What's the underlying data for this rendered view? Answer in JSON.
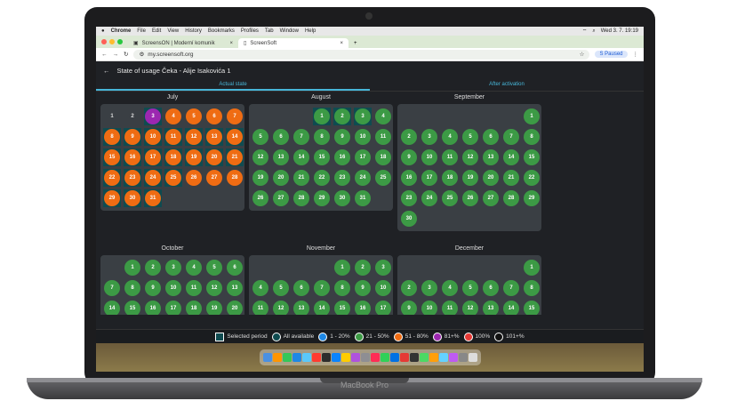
{
  "menubar": {
    "app": "Chrome",
    "items": [
      "File",
      "Edit",
      "View",
      "History",
      "Bookmarks",
      "Profiles",
      "Tab",
      "Window",
      "Help"
    ],
    "clock": "Wed 3. 7.  19:19"
  },
  "tabs": [
    {
      "label": "ScreensON | Moderní komunik",
      "close": "×"
    },
    {
      "label": "ScreenSoft",
      "close": "×"
    }
  ],
  "new_tab": "+",
  "address": {
    "url": "my.screensoft.org",
    "paused": "Paused",
    "profile_initial": "S"
  },
  "app": {
    "back": "←",
    "title": "State of usage  Čeka - Alije Isakovića 1"
  },
  "view_tabs": [
    {
      "label": "Actual state"
    },
    {
      "label": "After activation"
    }
  ],
  "months": [
    {
      "name": "July",
      "offset": 0,
      "days": [
        {
          "d": "1",
          "s": "n",
          "sel": false
        },
        {
          "d": "2",
          "s": "n",
          "sel": false
        },
        {
          "d": "3",
          "s": "p",
          "sel": true
        },
        {
          "d": "4",
          "s": "o",
          "sel": false
        },
        {
          "d": "5",
          "s": "o",
          "sel": false
        },
        {
          "d": "6",
          "s": "o",
          "sel": false
        },
        {
          "d": "7",
          "s": "o",
          "sel": false
        },
        {
          "d": "8",
          "s": "o",
          "sel": true
        },
        {
          "d": "9",
          "s": "o",
          "sel": true
        },
        {
          "d": "10",
          "s": "o",
          "sel": true
        },
        {
          "d": "11",
          "s": "o",
          "sel": true
        },
        {
          "d": "12",
          "s": "o",
          "sel": true
        },
        {
          "d": "13",
          "s": "o",
          "sel": true
        },
        {
          "d": "14",
          "s": "o",
          "sel": true
        },
        {
          "d": "15",
          "s": "o",
          "sel": true
        },
        {
          "d": "16",
          "s": "o",
          "sel": true
        },
        {
          "d": "17",
          "s": "o",
          "sel": true
        },
        {
          "d": "18",
          "s": "o",
          "sel": true
        },
        {
          "d": "19",
          "s": "o",
          "sel": true
        },
        {
          "d": "20",
          "s": "o",
          "sel": true
        },
        {
          "d": "21",
          "s": "o",
          "sel": true
        },
        {
          "d": "22",
          "s": "o",
          "sel": true
        },
        {
          "d": "23",
          "s": "o",
          "sel": true
        },
        {
          "d": "24",
          "s": "o",
          "sel": true
        },
        {
          "d": "25",
          "s": "o",
          "sel": true
        },
        {
          "d": "26",
          "s": "o",
          "sel": false
        },
        {
          "d": "27",
          "s": "o",
          "sel": false
        },
        {
          "d": "28",
          "s": "o",
          "sel": false
        },
        {
          "d": "29",
          "s": "o",
          "sel": true
        },
        {
          "d": "30",
          "s": "o",
          "sel": true
        },
        {
          "d": "31",
          "s": "o",
          "sel": true
        }
      ]
    },
    {
      "name": "August",
      "offset": 3,
      "days": [
        {
          "d": "1",
          "s": "g",
          "sel": true
        },
        {
          "d": "2",
          "s": "g",
          "sel": true
        },
        {
          "d": "3",
          "s": "g",
          "sel": true
        },
        {
          "d": "4",
          "s": "g",
          "sel": false
        },
        {
          "d": "5",
          "s": "g"
        },
        {
          "d": "6",
          "s": "g"
        },
        {
          "d": "7",
          "s": "g"
        },
        {
          "d": "8",
          "s": "g"
        },
        {
          "d": "9",
          "s": "g"
        },
        {
          "d": "10",
          "s": "g"
        },
        {
          "d": "11",
          "s": "g"
        },
        {
          "d": "12",
          "s": "g"
        },
        {
          "d": "13",
          "s": "g"
        },
        {
          "d": "14",
          "s": "g"
        },
        {
          "d": "15",
          "s": "g"
        },
        {
          "d": "16",
          "s": "g"
        },
        {
          "d": "17",
          "s": "g"
        },
        {
          "d": "18",
          "s": "g"
        },
        {
          "d": "19",
          "s": "g"
        },
        {
          "d": "20",
          "s": "g"
        },
        {
          "d": "21",
          "s": "g"
        },
        {
          "d": "22",
          "s": "g"
        },
        {
          "d": "23",
          "s": "g"
        },
        {
          "d": "24",
          "s": "g"
        },
        {
          "d": "25",
          "s": "g"
        },
        {
          "d": "26",
          "s": "g"
        },
        {
          "d": "27",
          "s": "g"
        },
        {
          "d": "28",
          "s": "g"
        },
        {
          "d": "29",
          "s": "g"
        },
        {
          "d": "30",
          "s": "g"
        },
        {
          "d": "31",
          "s": "g"
        }
      ]
    },
    {
      "name": "September",
      "offset": 6,
      "days": [
        {
          "d": "1",
          "s": "g"
        },
        {
          "d": "2",
          "s": "g"
        },
        {
          "d": "3",
          "s": "g"
        },
        {
          "d": "4",
          "s": "g"
        },
        {
          "d": "5",
          "s": "g"
        },
        {
          "d": "6",
          "s": "g"
        },
        {
          "d": "7",
          "s": "g"
        },
        {
          "d": "8",
          "s": "g"
        },
        {
          "d": "9",
          "s": "g"
        },
        {
          "d": "10",
          "s": "g"
        },
        {
          "d": "11",
          "s": "g"
        },
        {
          "d": "12",
          "s": "g"
        },
        {
          "d": "13",
          "s": "g"
        },
        {
          "d": "14",
          "s": "g"
        },
        {
          "d": "15",
          "s": "g"
        },
        {
          "d": "16",
          "s": "g"
        },
        {
          "d": "17",
          "s": "g"
        },
        {
          "d": "18",
          "s": "g"
        },
        {
          "d": "19",
          "s": "g"
        },
        {
          "d": "20",
          "s": "g"
        },
        {
          "d": "21",
          "s": "g"
        },
        {
          "d": "22",
          "s": "g"
        },
        {
          "d": "23",
          "s": "g"
        },
        {
          "d": "24",
          "s": "g"
        },
        {
          "d": "25",
          "s": "g"
        },
        {
          "d": "26",
          "s": "g"
        },
        {
          "d": "27",
          "s": "g"
        },
        {
          "d": "28",
          "s": "g"
        },
        {
          "d": "29",
          "s": "g"
        },
        {
          "d": "30",
          "s": "g"
        }
      ]
    },
    {
      "name": "October",
      "offset": 1,
      "days": [
        {
          "d": "1",
          "s": "g"
        },
        {
          "d": "2",
          "s": "g"
        },
        {
          "d": "3",
          "s": "g"
        },
        {
          "d": "4",
          "s": "g"
        },
        {
          "d": "5",
          "s": "g"
        },
        {
          "d": "6",
          "s": "g"
        },
        {
          "d": "7",
          "s": "g"
        },
        {
          "d": "8",
          "s": "g"
        },
        {
          "d": "9",
          "s": "g"
        },
        {
          "d": "10",
          "s": "g"
        },
        {
          "d": "11",
          "s": "g"
        },
        {
          "d": "12",
          "s": "g"
        },
        {
          "d": "13",
          "s": "g"
        },
        {
          "d": "14",
          "s": "g"
        },
        {
          "d": "15",
          "s": "g"
        },
        {
          "d": "16",
          "s": "g"
        },
        {
          "d": "17",
          "s": "g"
        },
        {
          "d": "18",
          "s": "g"
        },
        {
          "d": "19",
          "s": "g"
        },
        {
          "d": "20",
          "s": "g"
        }
      ]
    },
    {
      "name": "November",
      "offset": 4,
      "days": [
        {
          "d": "1",
          "s": "g"
        },
        {
          "d": "2",
          "s": "g"
        },
        {
          "d": "3",
          "s": "g"
        },
        {
          "d": "4",
          "s": "g"
        },
        {
          "d": "5",
          "s": "g"
        },
        {
          "d": "6",
          "s": "g"
        },
        {
          "d": "7",
          "s": "g"
        },
        {
          "d": "8",
          "s": "g"
        },
        {
          "d": "9",
          "s": "g"
        },
        {
          "d": "10",
          "s": "g"
        },
        {
          "d": "11",
          "s": "g"
        },
        {
          "d": "12",
          "s": "g"
        },
        {
          "d": "13",
          "s": "g"
        },
        {
          "d": "14",
          "s": "g"
        },
        {
          "d": "15",
          "s": "g"
        },
        {
          "d": "16",
          "s": "g"
        },
        {
          "d": "17",
          "s": "g"
        }
      ]
    },
    {
      "name": "December",
      "offset": 6,
      "days": [
        {
          "d": "1",
          "s": "g"
        },
        {
          "d": "2",
          "s": "g"
        },
        {
          "d": "3",
          "s": "g"
        },
        {
          "d": "4",
          "s": "g"
        },
        {
          "d": "5",
          "s": "g"
        },
        {
          "d": "6",
          "s": "g"
        },
        {
          "d": "7",
          "s": "g"
        },
        {
          "d": "8",
          "s": "g"
        },
        {
          "d": "9",
          "s": "g"
        },
        {
          "d": "10",
          "s": "g"
        },
        {
          "d": "11",
          "s": "g"
        },
        {
          "d": "12",
          "s": "g"
        },
        {
          "d": "13",
          "s": "g"
        },
        {
          "d": "14",
          "s": "g"
        },
        {
          "d": "15",
          "s": "g"
        }
      ]
    }
  ],
  "legend": [
    {
      "label": "Selected period",
      "kind": "square",
      "color": "#0f4b50"
    },
    {
      "label": "All available",
      "kind": "circle",
      "color": "#0f4b50"
    },
    {
      "label": "1 - 20%",
      "kind": "circle",
      "color": "#1e88e5"
    },
    {
      "label": "21 - 50%",
      "kind": "circle",
      "color": "#3c9a45"
    },
    {
      "label": "51 - 80%",
      "kind": "circle",
      "color": "#ef6c13"
    },
    {
      "label": "81+%",
      "kind": "circle",
      "color": "#9c27b0"
    },
    {
      "label": "100%",
      "kind": "circle",
      "color": "#e53935"
    },
    {
      "label": "101+%",
      "kind": "circle",
      "color": "#111111"
    }
  ],
  "colors": {
    "accent": "#47b6d8",
    "green": "#3c9a45",
    "orange": "#ef6c13",
    "purple": "#9c27b0",
    "selected": "#0f4b50"
  },
  "laptop_label": "MacBook Pro"
}
